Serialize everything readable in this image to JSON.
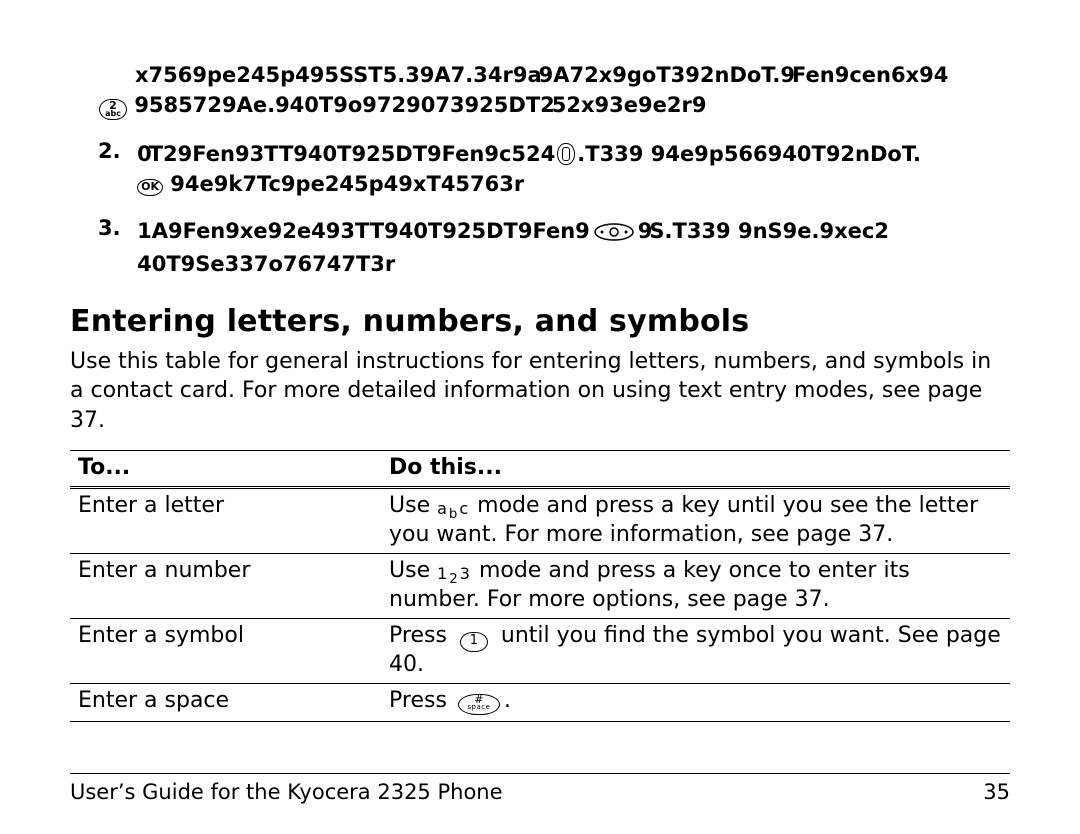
{
  "garble": {
    "l1a": "x7569pe245p495SST5.39A7.34r9",
    "l1b": "9A72x9goT392nDoT.",
    "l1c": "Fen9cen6x94",
    "l1d": "9585729Ae.940T9o9729073925DT",
    "l1e": "52x93e9e2r9",
    "n2a": "T29Fen93TT940T925DT9Fen9c524",
    "n2b": ".T339    94e9p566940T92nDoT.",
    "n2c": "94e9k7Tc9pe245p49xT45763r",
    "n3a": "1A9Fen9xe92e493TT940T925DT9Fen9",
    "n3b": "S.T339         9nS9e.9xec2",
    "n3c": "40T9Se337o76747T3r"
  },
  "heading": "Entering letters, numbers, and symbols",
  "intro": "Use this table for general instructions for entering letters, numbers, and symbols in a contact card. For more detailed information on using text entry modes, see page 37.",
  "table": {
    "h1": "To...",
    "h2": "Do this...",
    "rows": [
      {
        "to": "Enter a letter",
        "pre": "Use ",
        "mode": "aᵇc",
        "post": " mode and press a key until you see the letter you want. For more information, see page 37."
      },
      {
        "to": "Enter a number",
        "pre": "Use ",
        "mode": "1₂3",
        "post": " mode and press a key once to enter its number. For more options, see page 37."
      },
      {
        "to": "Enter a symbol",
        "pre": "Press ",
        "post": " until you find the symbol you want. See page 40."
      },
      {
        "to": "Enter a space",
        "pre": "Press ",
        "post": "."
      }
    ]
  },
  "footer": {
    "left": "User’s Guide for the Kyocera 2325 Phone",
    "right": "35"
  },
  "numbers": {
    "two": "2.",
    "three": "3."
  }
}
